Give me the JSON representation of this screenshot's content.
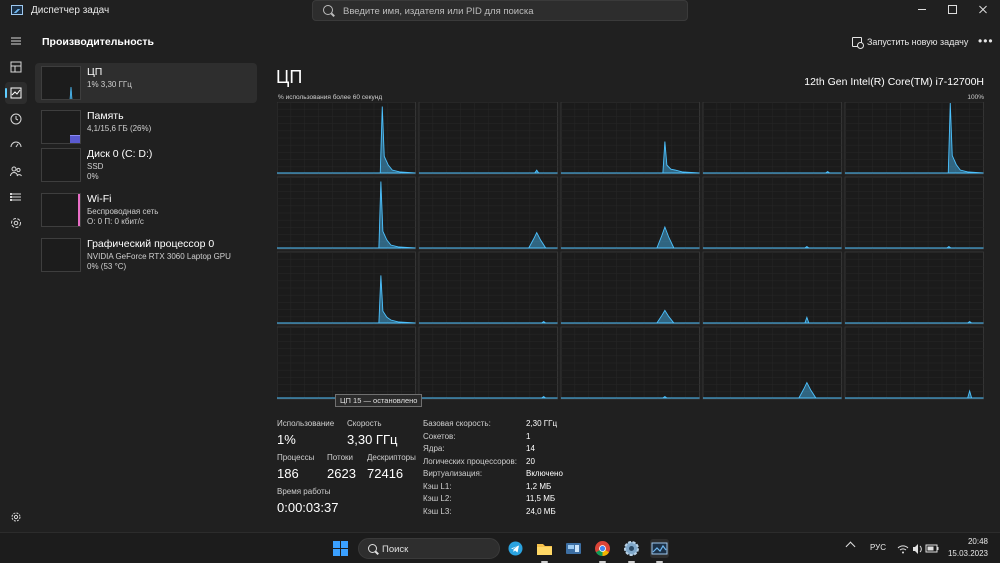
{
  "window": {
    "title": "Диспетчер задач",
    "search_placeholder": "Введите имя, издателя или PID для поиска"
  },
  "header": {
    "title": "Производительность",
    "run_task_label": "Запустить новую задачу",
    "more_label": "•••"
  },
  "nav": {
    "icons": [
      "hamburger-icon",
      "processes-icon",
      "performance-icon",
      "app-history-icon",
      "startup-icon",
      "users-icon",
      "details-icon",
      "services-icon",
      "settings-icon"
    ]
  },
  "perf_items": [
    {
      "name": "ЦП",
      "sub1": "1% 3,30 ГГц",
      "sub2": "",
      "color": "#4cc2ff"
    },
    {
      "name": "Память",
      "sub1": "4,1/15,6 ГБ (26%)",
      "sub2": "",
      "color": "#8c8cf5",
      "level_percent": 26
    },
    {
      "name": "Диск 0 (C: D:)",
      "sub1": "SSD",
      "sub2": "0%",
      "color": "#6ccf7f"
    },
    {
      "name": "Wi-Fi",
      "sub1": "Беспроводная сеть",
      "sub2": "О: 0 П: 0 кбит/с",
      "color": "#e86ec6"
    },
    {
      "name": "Графический процессор 0",
      "sub1": "NVIDIA GeForce RTX 3060 Laptop GPU",
      "sub2": "0% (53 °C)",
      "color": "#4cc2ff"
    }
  ],
  "cpu": {
    "title": "ЦП",
    "model": "12th Gen Intel(R) Core(TM) i7-12700H",
    "graph_caption": "% использования более 60 секунд",
    "graph_max": "100%",
    "tooltip": "ЦП 15 — остановлено",
    "line_color": "#4cc2ff",
    "cores_peak_percent": [
      95,
      4,
      45,
      2,
      100,
      95,
      22,
      30,
      2,
      2,
      68,
      2,
      18,
      8,
      2,
      2,
      2,
      2,
      22,
      10
    ]
  },
  "stats": {
    "usage_label": "Использование",
    "usage_value": "1%",
    "speed_label": "Скорость",
    "speed_value": "3,30 ГГц",
    "processes_label": "Процессы",
    "processes_value": "186",
    "threads_label": "Потоки",
    "threads_value": "2623",
    "handles_label": "Дескрипторы",
    "handles_value": "72416",
    "uptime_label": "Время работы",
    "uptime_value": "0:00:03:37"
  },
  "specs": [
    {
      "label": "Базовая скорость:",
      "value": "2,30 ГГц"
    },
    {
      "label": "Сокетов:",
      "value": "1"
    },
    {
      "label": "Ядра:",
      "value": "14"
    },
    {
      "label": "Логических процессоров:",
      "value": "20"
    },
    {
      "label": "Виртуализация:",
      "value": "Включено"
    },
    {
      "label": "Кэш L1:",
      "value": "1,2 МБ"
    },
    {
      "label": "Кэш L2:",
      "value": "11,5 МБ"
    },
    {
      "label": "Кэш L3:",
      "value": "24,0 МБ"
    }
  ],
  "taskbar": {
    "search_label": "Поиск",
    "apps": [
      "telegram-icon",
      "file-explorer-icon",
      "task-view-icon",
      "chrome-icon",
      "settings-gear-icon",
      "task-manager-icon"
    ],
    "lang": "РУС",
    "time": "20:48",
    "date": "15.03.2023"
  }
}
